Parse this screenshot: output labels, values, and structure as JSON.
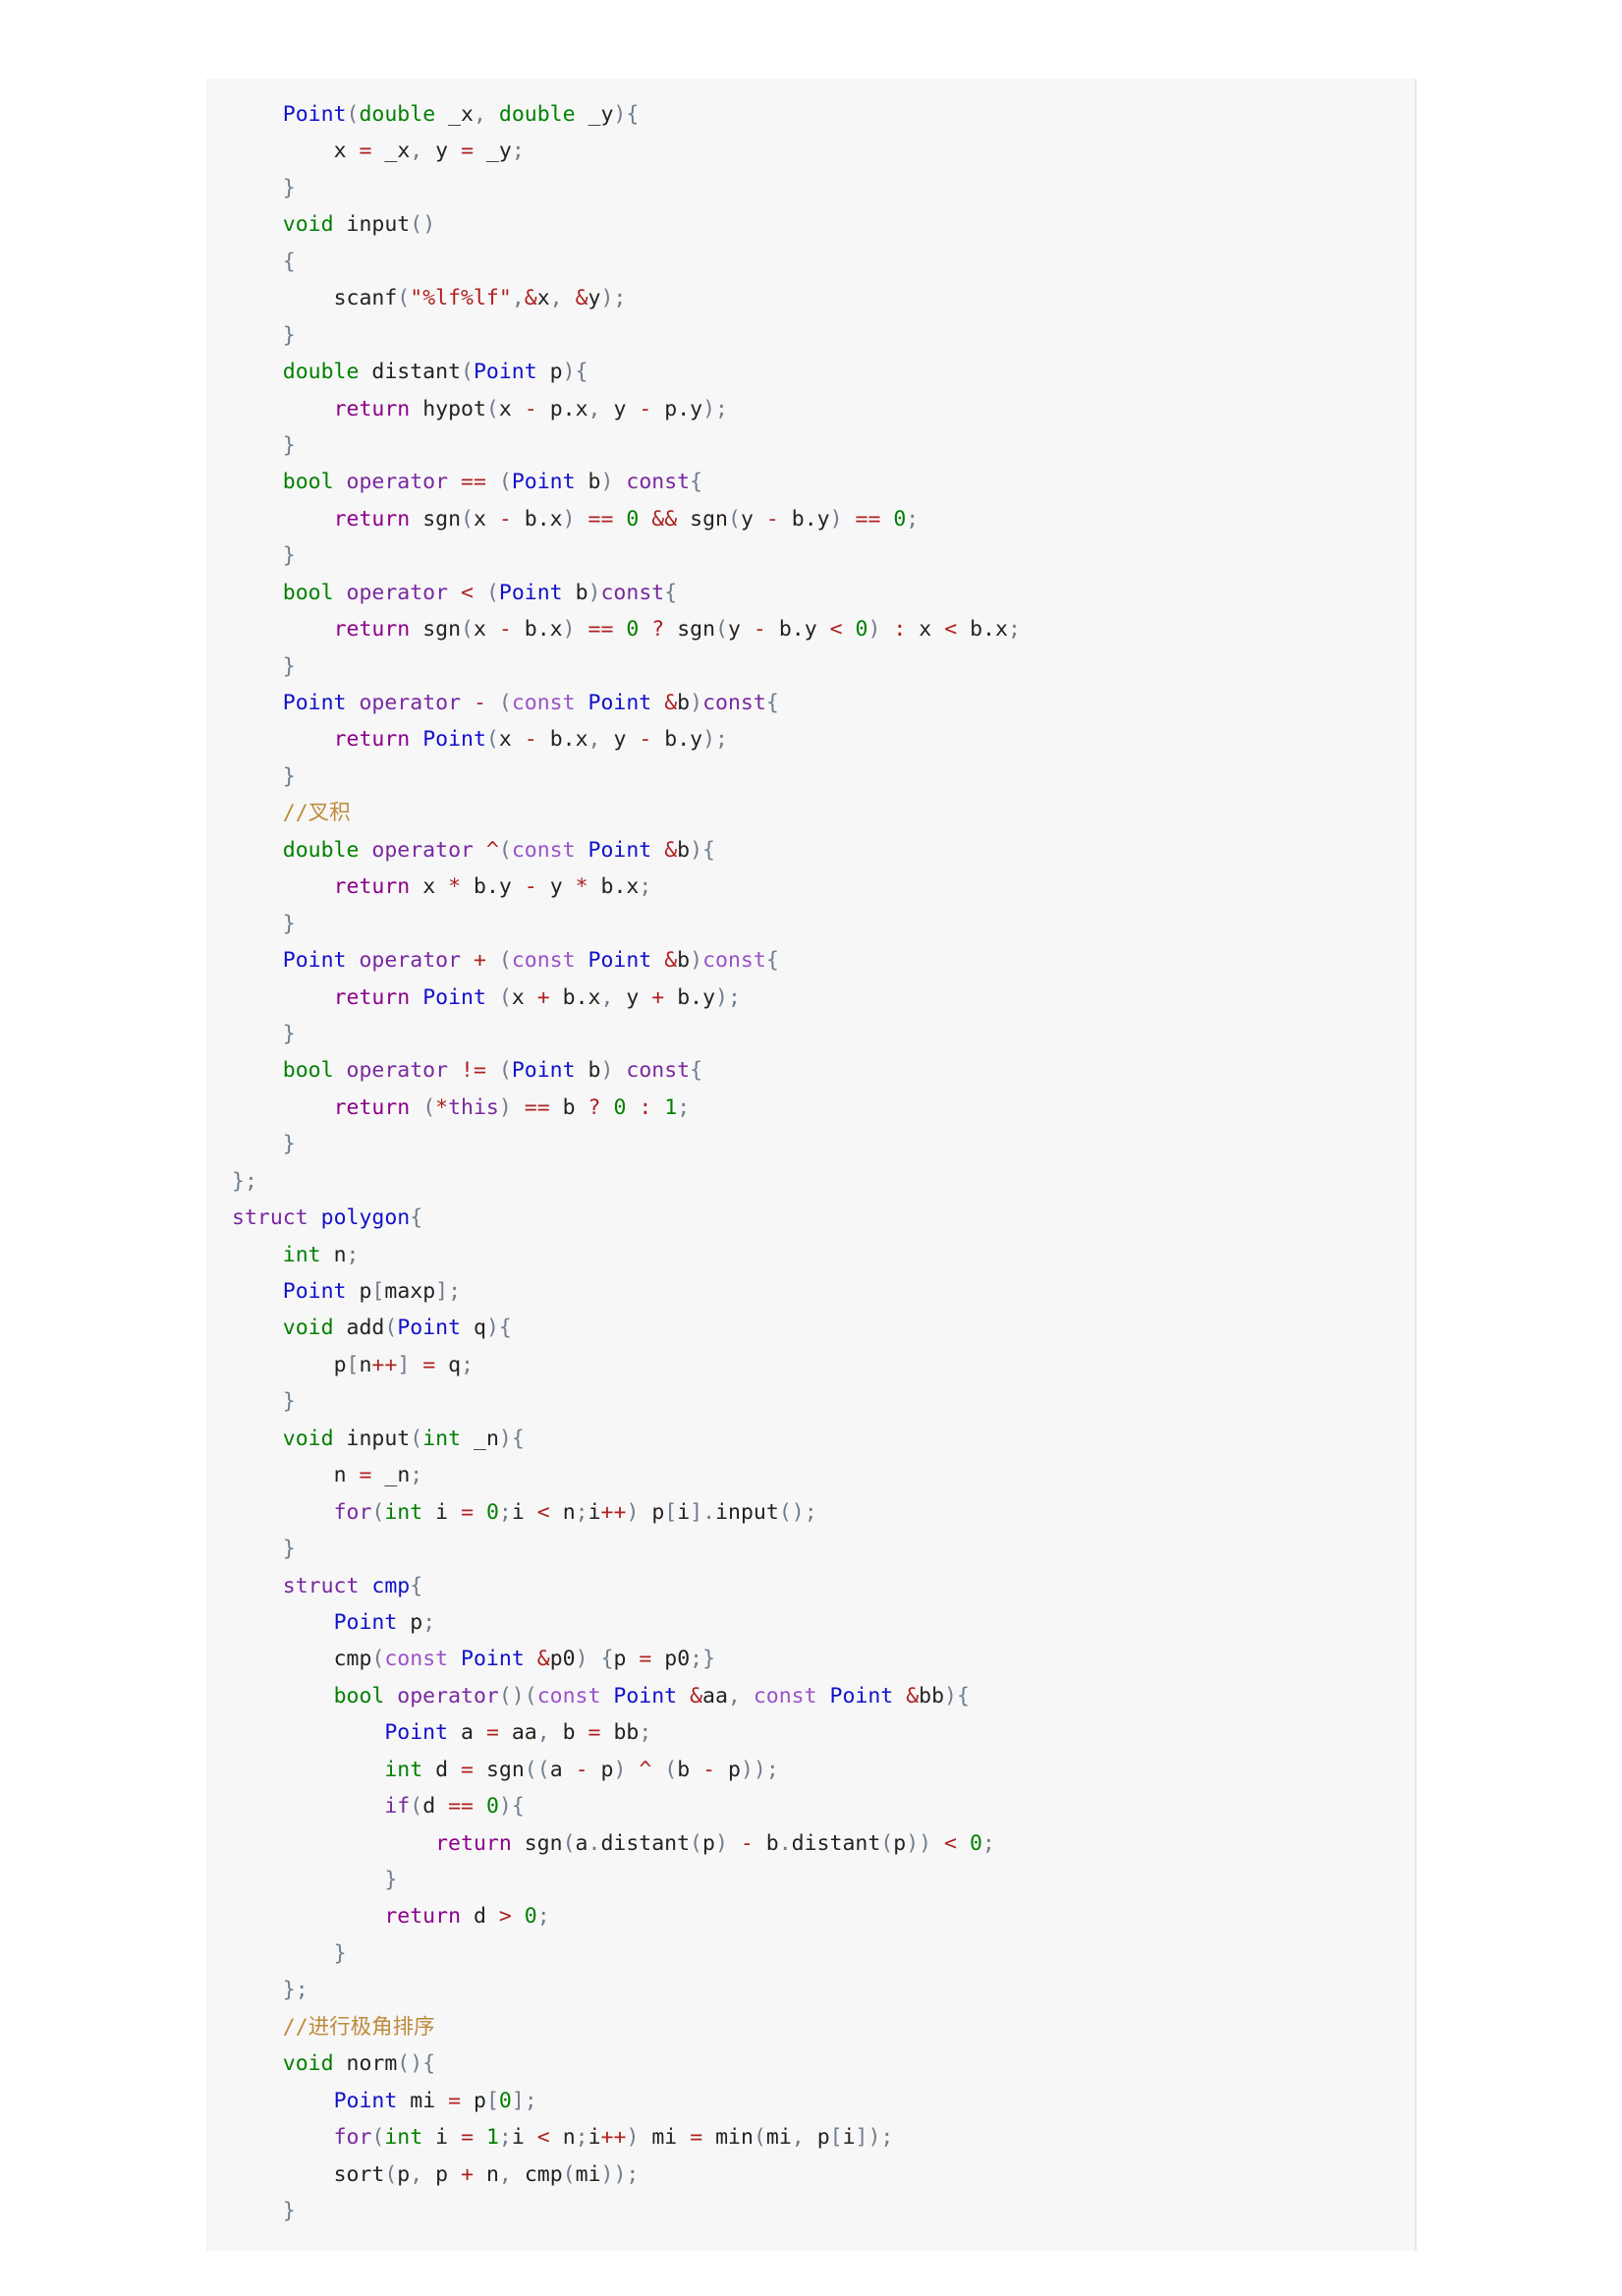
{
  "page": {
    "background_color": "#ffffff",
    "code_block_background": "#f7f7f7",
    "code_block_border_color": "#e3e8ee",
    "language": "cpp"
  },
  "theme": {
    "default_text": "#333333",
    "type_keyword": "#008000",
    "control_keyword": "#7928a1",
    "return_keyword": "#8b008b",
    "operator": "#b02020",
    "string_literal": "#b02020",
    "number_literal": "#008000",
    "class_name": "#1111cc",
    "comment": "#bf8a3d",
    "punctuation": "#6f7d8c",
    "const_keyword": "#9a52c9"
  },
  "code": {
    "lines": [
      "    Point(double _x, double _y){",
      "        x = _x, y = _y;",
      "    }",
      "    void input()",
      "    {",
      "        scanf(\"%lf%lf\",&x, &y);",
      "    }",
      "    double distant(Point p){",
      "        return hypot(x - p.x, y - p.y);",
      "    }",
      "    bool operator == (Point b) const{",
      "        return sgn(x - b.x) == 0 && sgn(y - b.y) == 0;",
      "    }",
      "    bool operator < (Point b)const{",
      "        return sgn(x - b.x) == 0 ? sgn(y - b.y < 0) : x < b.x;",
      "    }",
      "    Point operator - (const Point &b)const{",
      "        return Point(x - b.x, y - b.y);",
      "    }",
      "    //叉积",
      "    double operator ^(const Point &b){",
      "        return x * b.y - y * b.x;",
      "    }",
      "    Point operator + (const Point &b)const{",
      "        return Point (x + b.x, y + b.y);",
      "    }",
      "    bool operator != (Point b) const{",
      "        return (*this) == b ? 0 : 1;",
      "    }",
      "};",
      "struct polygon{",
      "    int n;",
      "    Point p[maxp];",
      "    void add(Point q){",
      "        p[n++] = q;",
      "    }",
      "    void input(int _n){",
      "        n = _n;",
      "        for(int i = 0;i < n;i++) p[i].input();",
      "    }",
      "    struct cmp{",
      "        Point p;",
      "        cmp(const Point &p0) {p = p0;}",
      "        bool operator()(const Point &aa, const Point &bb){",
      "            Point a = aa, b = bb;",
      "            int d = sgn((a - p) ^ (b - p));",
      "            if(d == 0){",
      "                return sgn(a.distant(p) - b.distant(p)) < 0;",
      "            }",
      "            return d > 0;",
      "        }",
      "    };",
      "    //进行极角排序",
      "    void norm(){",
      "        Point mi = p[0];",
      "        for(int i = 1;i < n;i++) mi = min(mi, p[i]);",
      "        sort(p, p + n, cmp(mi));",
      "    }"
    ],
    "comments": [
      "//叉积",
      "//进行极角排序"
    ],
    "strings": [
      "\"%lf%lf\""
    ],
    "identifiers_declared": [
      "Point",
      "polygon",
      "cmp",
      "input",
      "distant",
      "add",
      "norm",
      "maxp",
      "sgn",
      "hypot",
      "scanf",
      "sort",
      "min"
    ]
  }
}
